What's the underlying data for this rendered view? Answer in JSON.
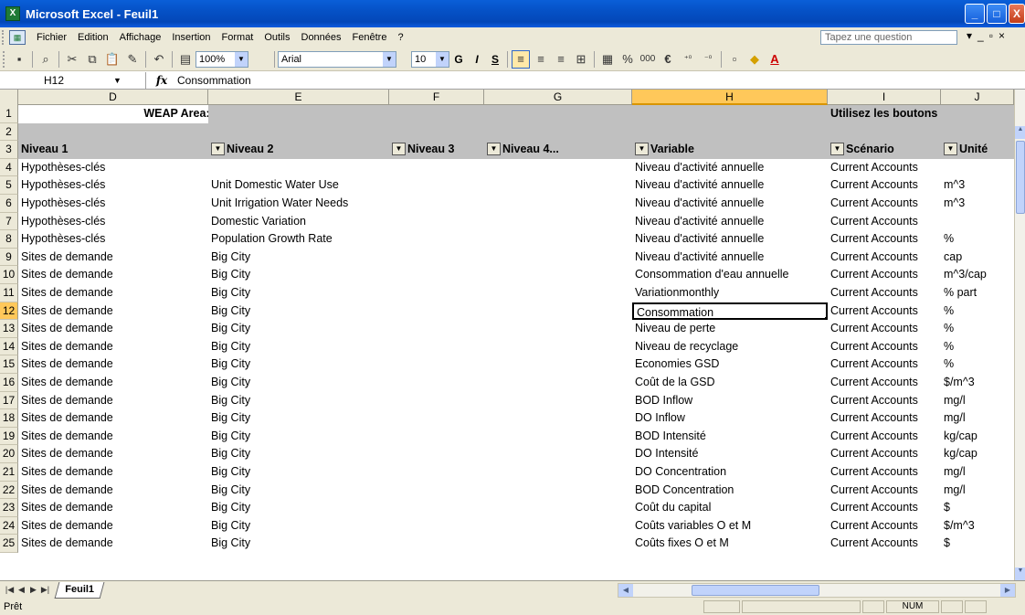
{
  "window": {
    "title": "Microsoft Excel - Feuil1",
    "buttons": [
      "_",
      "□",
      "X"
    ]
  },
  "menubar": {
    "items": [
      "Fichier",
      "Edition",
      "Affichage",
      "Insertion",
      "Format",
      "Outils",
      "Données",
      "Fenêtre",
      "?"
    ],
    "question_placeholder": "Tapez une question"
  },
  "toolbar": {
    "zoom": "100%",
    "font_name": "Arial",
    "font_size": "10",
    "bold": "G",
    "italic": "I",
    "underline": "S",
    "percent": "%",
    "thousands": "000",
    "euro": "€"
  },
  "formula_bar": {
    "name_box": "H12",
    "fx": "fx",
    "content": "Consommation"
  },
  "columns": [
    "D",
    "E",
    "F",
    "G",
    "H",
    "I",
    "J"
  ],
  "selected_column": "H",
  "selected_row": "12",
  "rows": [
    {
      "n": "1",
      "d": "WEAP Area: Tutorial",
      "e": "",
      "f": "",
      "g": "",
      "h": "",
      "i": "Utilisez les boutons ci-dessous",
      "j": ""
    },
    {
      "n": "2",
      "d": "",
      "e": "",
      "f": "",
      "g": "",
      "h": "",
      "i": "",
      "j": ""
    },
    {
      "n": "3",
      "d": "Niveau 1",
      "e": "Niveau 2",
      "f": "Niveau 3",
      "g": "Niveau 4...",
      "h": "Variable",
      "i": "Scénario",
      "j": "Unité"
    },
    {
      "n": "4",
      "d": "Hypothèses-clés",
      "e": "",
      "h": "Niveau d'activité annuelle",
      "i": "Current Accounts",
      "j": ""
    },
    {
      "n": "5",
      "d": "Hypothèses-clés",
      "e": "Unit Domestic Water Use",
      "h": "Niveau d'activité annuelle",
      "i": "Current Accounts",
      "j": "m^3"
    },
    {
      "n": "6",
      "d": "Hypothèses-clés",
      "e": "Unit Irrigation Water Needs",
      "h": "Niveau d'activité annuelle",
      "i": "Current Accounts",
      "j": "m^3"
    },
    {
      "n": "7",
      "d": "Hypothèses-clés",
      "e": "Domestic Variation",
      "h": "Niveau d'activité annuelle",
      "i": "Current Accounts",
      "j": ""
    },
    {
      "n": "8",
      "d": "Hypothèses-clés",
      "e": "Population Growth Rate",
      "h": "Niveau d'activité annuelle",
      "i": "Current Accounts",
      "j": "%"
    },
    {
      "n": "9",
      "d": "Sites de demande",
      "e": "Big City",
      "h": "Niveau d'activité annuelle",
      "i": "Current Accounts",
      "j": "cap"
    },
    {
      "n": "10",
      "d": "Sites de demande",
      "e": "Big City",
      "h": "Consommation d'eau annuelle",
      "i": "Current Accounts",
      "j": "m^3/cap"
    },
    {
      "n": "11",
      "d": "Sites de demande",
      "e": "Big City",
      "h": "Variationmonthly",
      "i": "Current Accounts",
      "j": "% part"
    },
    {
      "n": "12",
      "d": "Sites de demande",
      "e": "Big City",
      "h": "Consommation",
      "i": "Current Accounts",
      "j": "%"
    },
    {
      "n": "13",
      "d": "Sites de demande",
      "e": "Big City",
      "h": "Niveau de perte",
      "i": "Current Accounts",
      "j": "%"
    },
    {
      "n": "14",
      "d": "Sites de demande",
      "e": "Big City",
      "h": "Niveau de recyclage",
      "i": "Current Accounts",
      "j": "%"
    },
    {
      "n": "15",
      "d": "Sites de demande",
      "e": "Big City",
      "h": "Economies GSD",
      "i": "Current Accounts",
      "j": "%"
    },
    {
      "n": "16",
      "d": "Sites de demande",
      "e": "Big City",
      "h": "Coût de la GSD",
      "i": "Current Accounts",
      "j": "$/m^3"
    },
    {
      "n": "17",
      "d": "Sites de demande",
      "e": "Big City",
      "h": "BOD Inflow",
      "i": "Current Accounts",
      "j": "mg/l"
    },
    {
      "n": "18",
      "d": "Sites de demande",
      "e": "Big City",
      "h": "DO Inflow",
      "i": "Current Accounts",
      "j": "mg/l"
    },
    {
      "n": "19",
      "d": "Sites de demande",
      "e": "Big City",
      "h": "BOD Intensité",
      "i": "Current Accounts",
      "j": "kg/cap"
    },
    {
      "n": "20",
      "d": "Sites de demande",
      "e": "Big City",
      "h": "DO Intensité",
      "i": "Current Accounts",
      "j": "kg/cap"
    },
    {
      "n": "21",
      "d": "Sites de demande",
      "e": "Big City",
      "h": "DO Concentration",
      "i": "Current Accounts",
      "j": "mg/l"
    },
    {
      "n": "22",
      "d": "Sites de demande",
      "e": "Big City",
      "h": "BOD Concentration",
      "i": "Current Accounts",
      "j": "mg/l"
    },
    {
      "n": "23",
      "d": "Sites de demande",
      "e": "Big City",
      "h": "Coût du capital",
      "i": "Current Accounts",
      "j": "$"
    },
    {
      "n": "24",
      "d": "Sites de demande",
      "e": "Big City",
      "h": "Coûts variables O et M",
      "i": "Current Accounts",
      "j": "$/m^3"
    },
    {
      "n": "25",
      "d": "Sites de demande",
      "e": "Big City",
      "h": "Coûts fixes O et M",
      "i": "Current Accounts",
      "j": "$"
    }
  ],
  "sheet_tabs": [
    "Feuil1"
  ],
  "statusbar": {
    "status": "Prêt",
    "num": "NUM"
  }
}
